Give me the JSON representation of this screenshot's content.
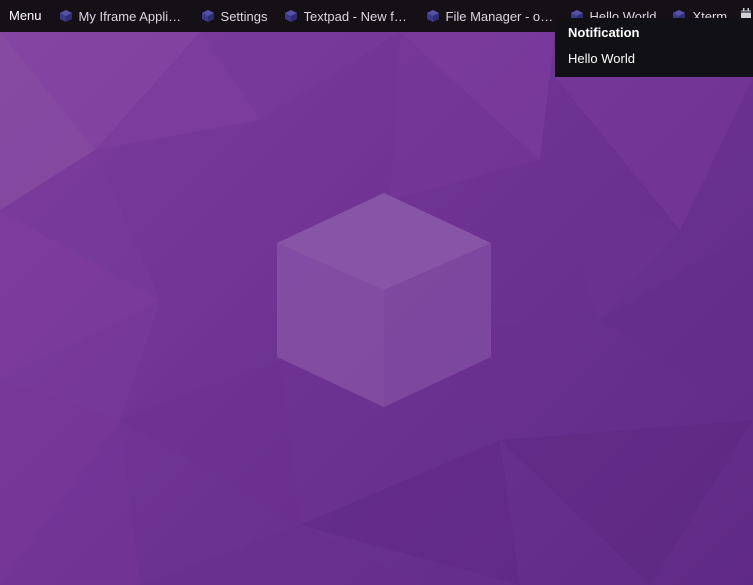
{
  "taskbar": {
    "menu_label": "Menu",
    "tasks": [
      {
        "label": "My Iframe Applic…",
        "icon": "cube-icon"
      },
      {
        "label": "Settings",
        "icon": "cube-icon"
      },
      {
        "label": "Textpad - New fil…",
        "icon": "cube-icon"
      },
      {
        "label": "File Manager - os…",
        "icon": "cube-icon"
      },
      {
        "label": "Hello World",
        "icon": "cube-icon"
      },
      {
        "label": "Xterm",
        "icon": "cube-icon"
      }
    ],
    "tray_icon": "calendar-icon"
  },
  "notification": {
    "title": "Notification",
    "message": "Hello World"
  },
  "colors": {
    "taskbar_bg": "#141016",
    "desktop_purple": "#6f3493",
    "notification_bg": "#111014",
    "cube_icon": "#3b3a8a"
  }
}
